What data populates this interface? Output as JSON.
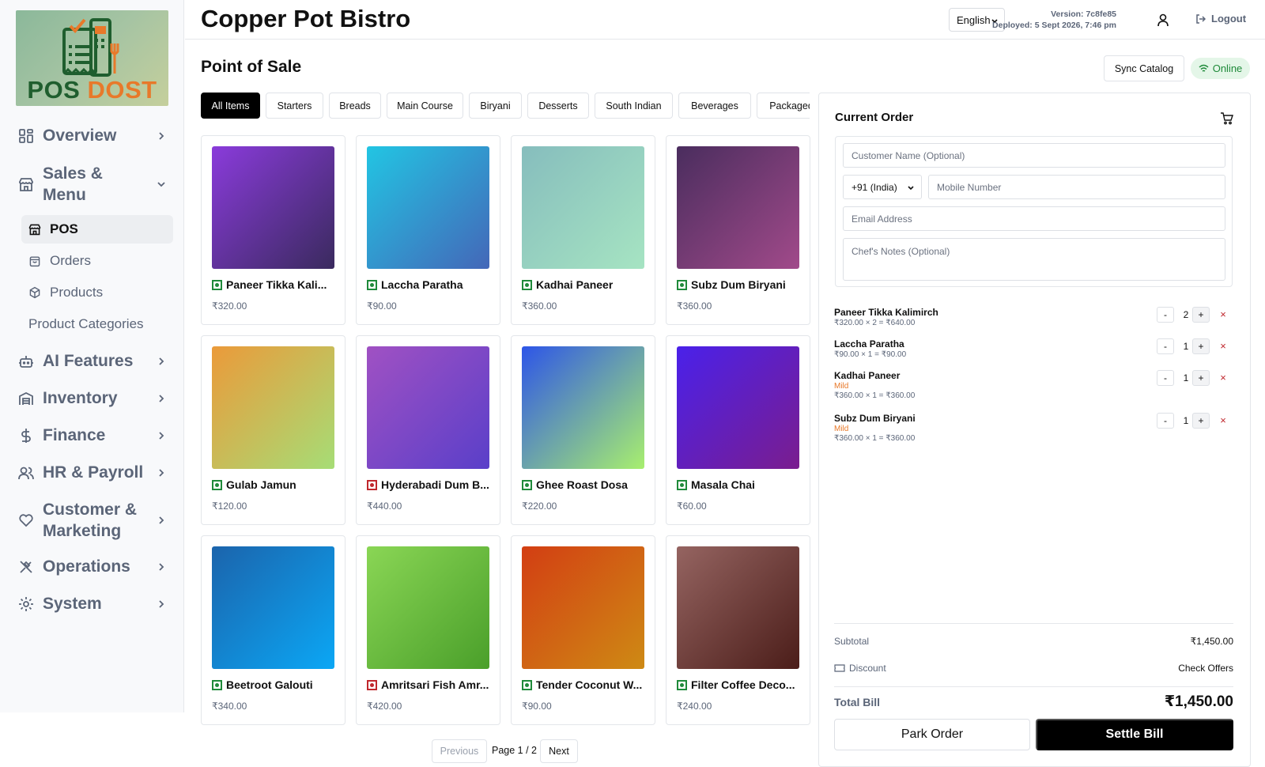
{
  "app": {
    "logo_text_1": "POS",
    "logo_text_2": "DOST",
    "brand": "Copper Pot Bistro",
    "language": "English",
    "version_line": "Version: 7c8fe85",
    "deployed_line": "Deployed: 5 Sept 2026, 7:46 pm",
    "logout_label": "Logout"
  },
  "sidebar": {
    "items": [
      {
        "label": "Overview",
        "icon": "grid-icon"
      },
      {
        "label": "Sales &\nMenu",
        "icon": "store-icon"
      },
      {
        "label": "AI Features",
        "icon": "bot-icon"
      },
      {
        "label": "Inventory",
        "icon": "warehouse-icon"
      },
      {
        "label": "Finance",
        "icon": "dollar-icon"
      },
      {
        "label": "HR & Payroll",
        "icon": "users-icon"
      },
      {
        "label": "Customer &\nMarketing",
        "icon": "heart-icon"
      },
      {
        "label": "Operations",
        "icon": "utensils-icon"
      },
      {
        "label": "System",
        "icon": "gear-icon"
      }
    ],
    "sub_items": [
      {
        "label": "POS",
        "icon": "store-icon",
        "active": true
      },
      {
        "label": "Orders",
        "icon": "bag-icon"
      },
      {
        "label": "Products",
        "icon": "box-icon"
      },
      {
        "label": "Product Categories"
      }
    ]
  },
  "page": {
    "title": "Point of Sale",
    "sync_label": "Sync Catalog",
    "status_label": "Online"
  },
  "tabs": [
    "All Items",
    "Starters",
    "Breads",
    "Main Course",
    "Biryani",
    "Desserts",
    "South Indian",
    "Beverages",
    "Packaged"
  ],
  "products": [
    {
      "name": "Paneer Tikka Kali...",
      "price": "₹320.00",
      "veg": true,
      "grad": [
        "#8a3bdb",
        "#3a2a5e"
      ]
    },
    {
      "name": "Laccha Paratha",
      "price": "₹90.00",
      "veg": true,
      "grad": [
        "#22c5e3",
        "#4467b8"
      ]
    },
    {
      "name": "Kadhai Paneer",
      "price": "₹360.00",
      "veg": true,
      "grad": [
        "#86bdbd",
        "#a6e4c2"
      ]
    },
    {
      "name": "Subz Dum Biryani",
      "price": "₹360.00",
      "veg": true,
      "grad": [
        "#4a2d5e",
        "#a14a8a"
      ]
    },
    {
      "name": "Gulab Jamun",
      "price": "₹120.00",
      "veg": true,
      "grad": [
        "#eb9a3a",
        "#a6dd76"
      ]
    },
    {
      "name": "Hyderabadi Dum B...",
      "price": "₹440.00",
      "veg": false,
      "grad": [
        "#a051c3",
        "#5a3fc9"
      ]
    },
    {
      "name": "Ghee Roast Dosa",
      "price": "₹220.00",
      "veg": true,
      "grad": [
        "#2d55e8",
        "#a8ef6e"
      ]
    },
    {
      "name": "Masala Chai",
      "price": "₹60.00",
      "veg": true,
      "grad": [
        "#4a21ea",
        "#7a1d8e"
      ]
    },
    {
      "name": "Beetroot Galouti",
      "price": "₹340.00",
      "veg": true,
      "grad": [
        "#1b64ac",
        "#0ba7f5"
      ]
    },
    {
      "name": "Amritsari Fish Amr...",
      "price": "₹420.00",
      "veg": false,
      "grad": [
        "#8ad655",
        "#4a9f2a"
      ]
    },
    {
      "name": "Tender Coconut W...",
      "price": "₹90.00",
      "veg": true,
      "grad": [
        "#d33e13",
        "#ce8a14"
      ]
    },
    {
      "name": "Filter Coffee Deco...",
      "price": "₹240.00",
      "veg": true,
      "grad": [
        "#956461",
        "#4b1d19"
      ]
    }
  ],
  "pagination": {
    "prev": "Previous",
    "info": "Page 1 / 2",
    "next": "Next"
  },
  "order": {
    "title": "Current Order",
    "customer_placeholder": "Customer Name (Optional)",
    "country_code": "+91 (India)",
    "mobile_placeholder": "Mobile Number",
    "email_placeholder": "Email Address",
    "notes_placeholder": "Chef's Notes (Optional)",
    "lines": [
      {
        "name": "Paneer Tikka Kalimirch",
        "modifier": "",
        "calc": "₹320.00 × 2 = ₹640.00",
        "qty": "2"
      },
      {
        "name": "Laccha Paratha",
        "modifier": "",
        "calc": "₹90.00 × 1 = ₹90.00",
        "qty": "1"
      },
      {
        "name": "Kadhai Paneer",
        "modifier": "Mild",
        "calc": "₹360.00 × 1 = ₹360.00",
        "qty": "1"
      },
      {
        "name": "Subz Dum Biryani",
        "modifier": "Mild",
        "calc": "₹360.00 × 1 = ₹360.00",
        "qty": "1"
      }
    ],
    "minus": "-",
    "plus": "+",
    "remove": "×",
    "subtotal_label": "Subtotal",
    "subtotal_value": "₹1,450.00",
    "discount_label": "Discount",
    "discount_action": "Check Offers",
    "total_label": "Total Bill",
    "total_value": "₹1,450.00",
    "park_label": "Park Order",
    "settle_label": "Settle Bill"
  }
}
